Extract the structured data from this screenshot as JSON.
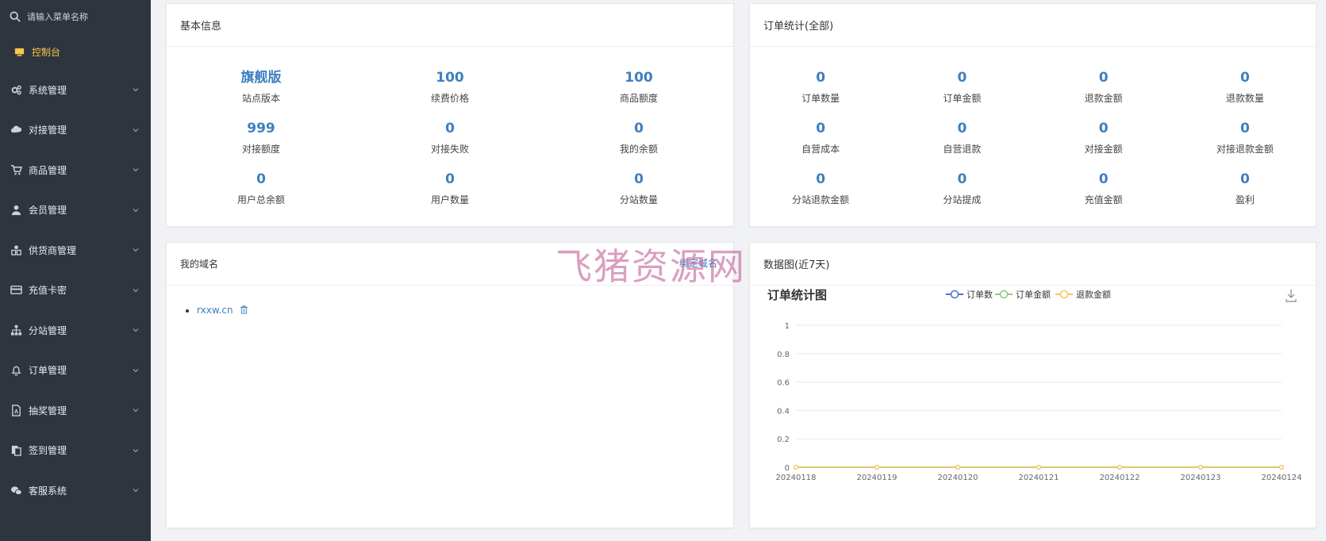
{
  "sidebar": {
    "search_placeholder": "请输入菜单名称",
    "items": [
      {
        "label": "控制台",
        "icon": "monitor-icon",
        "active": true
      },
      {
        "label": "系统管理",
        "icon": "gears-icon"
      },
      {
        "label": "对接管理",
        "icon": "cloud-icon"
      },
      {
        "label": "商品管理",
        "icon": "cart-icon"
      },
      {
        "label": "会员管理",
        "icon": "user-icon"
      },
      {
        "label": "供货商管理",
        "icon": "supplier-icon"
      },
      {
        "label": "充值卡密",
        "icon": "card-icon"
      },
      {
        "label": "分站管理",
        "icon": "sitemap-icon"
      },
      {
        "label": "订单管理",
        "icon": "bell-icon"
      },
      {
        "label": "抽奖管理",
        "icon": "file-icon"
      },
      {
        "label": "签到管理",
        "icon": "copy-icon"
      },
      {
        "label": "客服系统",
        "icon": "chat-icon"
      }
    ]
  },
  "basic": {
    "title": "基本信息",
    "stats": [
      {
        "value": "旗舰版",
        "label": "站点版本"
      },
      {
        "value": "100",
        "label": "续费价格"
      },
      {
        "value": "100",
        "label": "商品额度"
      },
      {
        "value": "999",
        "label": "对接额度"
      },
      {
        "value": "0",
        "label": "对接失败"
      },
      {
        "value": "0",
        "label": "我的余额"
      },
      {
        "value": "0",
        "label": "用户总余额"
      },
      {
        "value": "0",
        "label": "用户数量"
      },
      {
        "value": "0",
        "label": "分站数量"
      }
    ]
  },
  "orders": {
    "title": "订单统计(全部)",
    "stats": [
      {
        "value": "0",
        "label": "订单数量"
      },
      {
        "value": "0",
        "label": "订单金额"
      },
      {
        "value": "0",
        "label": "退款金额"
      },
      {
        "value": "0",
        "label": "退款数量"
      },
      {
        "value": "0",
        "label": "自营成本"
      },
      {
        "value": "0",
        "label": "自营退款"
      },
      {
        "value": "0",
        "label": "对接金额"
      },
      {
        "value": "0",
        "label": "对接退款金额"
      },
      {
        "value": "0",
        "label": "分站退款金额"
      },
      {
        "value": "0",
        "label": "分站提成"
      },
      {
        "value": "0",
        "label": "充值金额"
      },
      {
        "value": "0",
        "label": "盈利"
      }
    ]
  },
  "domain": {
    "title": "我的域名",
    "bind_label": "绑定域名",
    "items": [
      "rxxw.cn"
    ]
  },
  "chart_panel": {
    "title": "数据图(近7天)"
  },
  "watermark": "飞猪资源网",
  "chart_data": {
    "type": "line",
    "title": "订单统计图",
    "x": [
      "20240118",
      "20240119",
      "20240120",
      "20240121",
      "20240122",
      "20240123",
      "20240124"
    ],
    "series": [
      {
        "name": "订单数",
        "values": [
          0,
          0,
          0,
          0,
          0,
          0,
          0
        ],
        "color": "#5470c6"
      },
      {
        "name": "订单金额",
        "values": [
          0,
          0,
          0,
          0,
          0,
          0,
          0
        ],
        "color": "#91cc75"
      },
      {
        "name": "退款金额",
        "values": [
          0,
          0,
          0,
          0,
          0,
          0,
          0
        ],
        "color": "#fac858"
      }
    ],
    "yticks": [
      "0",
      "0.2",
      "0.4",
      "0.6",
      "0.8",
      "1"
    ],
    "ylim": [
      0,
      1
    ],
    "grid": true,
    "legend": "top-center"
  }
}
